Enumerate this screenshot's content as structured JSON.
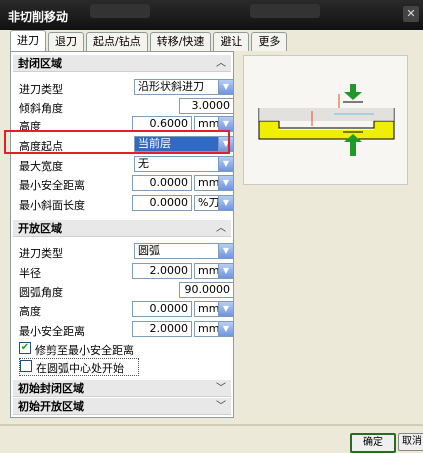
{
  "window": {
    "title": "非切削移动"
  },
  "tabs": [
    "进刀",
    "退刀",
    "起点/钻点",
    "转移/快速",
    "避让",
    "更多"
  ],
  "closed_area": {
    "title": "封闭区域",
    "entry_type_label": "进刀类型",
    "entry_type_value": "沿形状斜进刀",
    "ramp_angle_label": "倾斜角度",
    "ramp_angle_value": "3.0000",
    "height_label": "高度",
    "height_value": "0.6000",
    "height_unit": "mm",
    "height_start_label": "高度起点",
    "height_start_value": "当前层",
    "max_width_label": "最大宽度",
    "max_width_value": "无",
    "min_safe_label": "最小安全距离",
    "min_safe_value": "0.0000",
    "min_safe_unit": "mm",
    "min_ramp_label": "最小斜面长度",
    "min_ramp_value": "0.0000",
    "min_ramp_unit": "%刀具"
  },
  "open_area": {
    "title": "开放区域",
    "entry_type_label": "进刀类型",
    "entry_type_value": "圆弧",
    "radius_label": "半径",
    "radius_value": "2.0000",
    "radius_unit": "mm",
    "arc_angle_label": "圆弧角度",
    "arc_angle_value": "90.0000",
    "height_label": "高度",
    "height_value": "0.0000",
    "height_unit": "mm",
    "min_safe_label": "最小安全距离",
    "min_safe_value": "2.0000",
    "min_safe_unit": "mm",
    "trim_label": "修剪至最小安全距离",
    "center_label": "在圆弧中心处开始"
  },
  "initial_closed": {
    "title": "初始封闭区域"
  },
  "initial_open": {
    "title": "初始开放区域"
  },
  "buttons": {
    "ok": "确定",
    "cancel": "取消"
  },
  "colors": {
    "highlight": "#e0202a",
    "part": "#f0ef00",
    "arrow": "#1f9a2a"
  }
}
